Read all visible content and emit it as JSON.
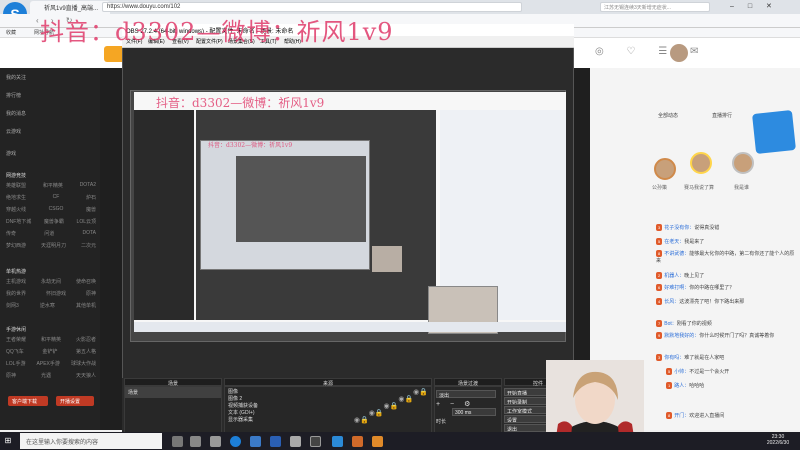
{
  "browser": {
    "tabs": [
      {
        "label": "祈风1v9直播_高端... "
      },
      {
        "label": "网站大全"
      }
    ],
    "url": "https://www.douyu.com/102",
    "search_placeholder": "江苏无锡连续3天新增无症状...",
    "bookmarks": [
      "收藏",
      "网址导航"
    ]
  },
  "watermark": {
    "main": "抖音：d3302—微博：祈风1v9",
    "preview": "抖音：d3302—微博：祈风1v9",
    "inner": "抖音：d3302—微博：祈风1v9"
  },
  "obs": {
    "title": "OBS 27.2.4 (64-bit, windows) - 配置文件: 未命名 - 场景: 未命名",
    "menu": [
      "文件(F)",
      "编辑(E)",
      "查看(V)",
      "配置文件(P)",
      "场景集合(S)",
      "工具(T)",
      "帮助(H)"
    ],
    "docks": {
      "scenes": {
        "header": "场景",
        "items": [
          "场景"
        ]
      },
      "sources": {
        "header": "来源",
        "items": [
          "图像",
          "图像 2",
          "视频捕获设备",
          "文本 (GDI+)",
          "显示器采集"
        ]
      },
      "transitions": {
        "header": "场景过渡",
        "select": "淡出",
        "duration_label": "时长",
        "duration": "300 ms"
      },
      "controls": {
        "header": "控件",
        "buttons": [
          "开始直播",
          "开始录制",
          "工作室模式",
          "设置",
          "退出"
        ]
      }
    }
  },
  "sidebar": {
    "items": [
      "我的关注",
      "排行榜",
      "我的消息",
      "云游戏",
      "游戏"
    ],
    "section_hot": "网游竞技",
    "grid": [
      [
        "英雄联盟",
        "和平精英",
        "DOTA2"
      ],
      [
        "绝地求生",
        "CF",
        "炉石"
      ],
      [
        "穿越火线",
        "CSGO",
        "魔兽"
      ],
      [
        "DNF地下城",
        "魔兽争霸",
        "LOL云顶"
      ],
      [
        "传奇",
        "问道",
        "DOTA"
      ],
      [
        "梦幻西游",
        "天涯明月刀",
        "二次元"
      ]
    ],
    "section_mobile": "单机热游",
    "grid2": [
      [
        "主机游戏",
        "永劫无间",
        "使命召唤"
      ],
      [
        "我的世界",
        "怀旧游戏",
        "原神"
      ],
      [
        "剑网3",
        "逆水寒",
        "其他单机"
      ]
    ],
    "section_ent": "手游休闲",
    "grid3": [
      [
        "王者荣耀",
        "和平精英",
        "火影忍者"
      ],
      [
        "QQ飞车",
        "金铲铲",
        "第五人格"
      ],
      [
        "LOL手游",
        "APEX手游",
        "球球大作战"
      ],
      [
        "原神",
        "光遇",
        "天天狼人"
      ]
    ],
    "btn_left": "客户端下载",
    "btn_right": "开播设置"
  },
  "chat": {
    "title": "全部动态",
    "tab": "直播排行",
    "rank_names": [
      "公孙策",
      "赛马我说了算",
      "我是谁"
    ],
    "rows": [
      {
        "badge": "3",
        "user": "花子没有你：",
        "text": "说得真没错"
      },
      {
        "badge": "5",
        "user": "在老天：",
        "text": "我是来了"
      },
      {
        "badge": "8",
        "user": "不讲武德：",
        "text": "能够最大化你的中路，第二有你还了能个人的原来"
      },
      {
        "badge": "2",
        "user": "机器人：",
        "text": "晚上见了"
      },
      {
        "badge": "6",
        "user": "好难打啊：",
        "text": "你的中路在哪里了？"
      },
      {
        "badge": "4",
        "user": "长风：",
        "text": "这波漂亮了吧！你下路出来那"
      },
      {
        "badge": "7",
        "user": "Bot：",
        "text": "刚看了你的视频"
      },
      {
        "badge": "9",
        "user": "默默地我好的：",
        "text": "你什么时候开门了吗？真诚等着你"
      },
      {
        "badge": "3",
        "user": "你有吗：",
        "text": "难了就是在人家吧"
      },
      {
        "badge": "5",
        "user": "小帅：",
        "text": "不过是一个会火开"
      },
      {
        "badge": "1",
        "user": "路人：",
        "text": "哈哈哈"
      },
      {
        "badge": "8",
        "user": "开门：",
        "text": "欢迎进入直播间"
      }
    ]
  },
  "taskbar": {
    "search_placeholder": "在这里输入你要搜索的内容",
    "time": "23:30",
    "date": "2022/6/30"
  }
}
